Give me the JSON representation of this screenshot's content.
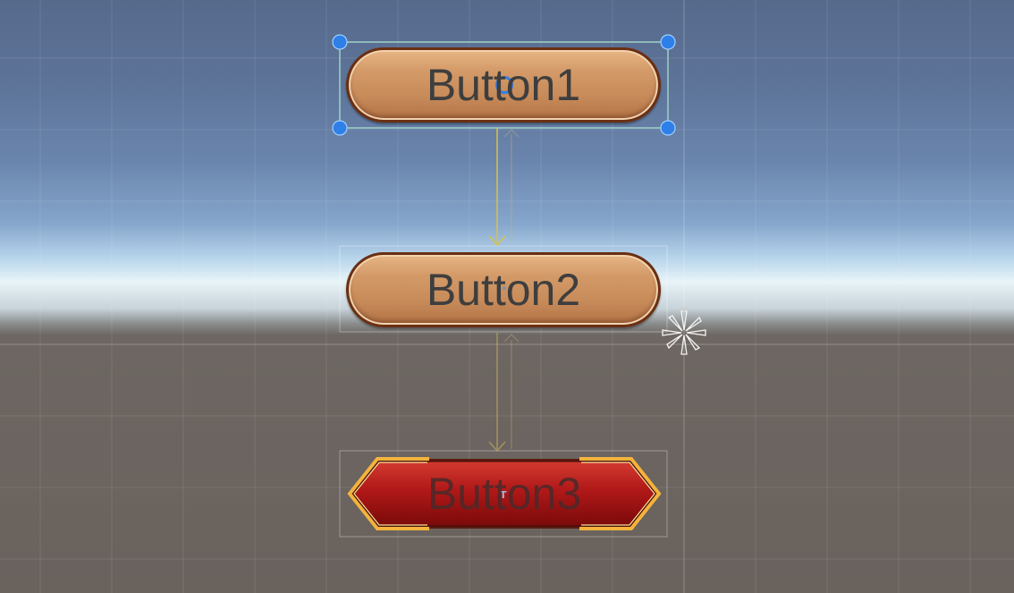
{
  "buttons": [
    {
      "label": "Button1",
      "style": "pill",
      "selected": true
    },
    {
      "label": "Button2",
      "style": "pill",
      "selected": false
    },
    {
      "label": "Button3",
      "style": "red-hexagon",
      "selected": false
    }
  ],
  "colors": {
    "sky_top": "#566a8c",
    "horizon": "#e8f4f8",
    "ground": "#6a625d",
    "pill_fill": "#d39a68",
    "pill_border": "#6a2f12",
    "red_fill": "#b01818",
    "gold_frame": "#f0b040",
    "selection_outline": "#9fd0c8",
    "handle_fill": "#2f7fe8",
    "nav_arrow": "#d8c24a"
  },
  "icons": {
    "pivot": "pivot-circle-icon",
    "anchor": "anchor-flower-icon",
    "text_component": "text-t-icon"
  }
}
